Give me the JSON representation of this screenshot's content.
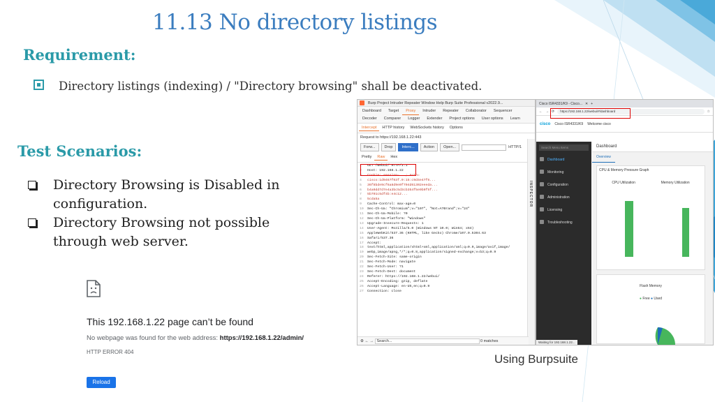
{
  "slide": {
    "title": "11.13 No directory listings",
    "requirement_heading": "Requirement:",
    "requirement_text": "Directory listings (indexing) / \"Directory browsing\" shall be deactivated.",
    "test_heading": "Test Scenarios:",
    "scenarios": [
      "Directory Browsing is Disabled in configuration.",
      "Directory Browsing not possible through web server."
    ],
    "caption": "Using Burpsuite"
  },
  "error_page": {
    "title": "This 192.168.1.22 page can’t be found",
    "desc_prefix": "No webpage was found for the web address: ",
    "desc_url": "https://192.168.1.22/admin/",
    "code": "HTTP ERROR 404",
    "reload_label": "Reload"
  },
  "burp": {
    "window_title": "Burp  Project  Intruder  Repeater  Window  Help  Burp Suite Professional v2022.9...",
    "tabs": [
      "Dashboard",
      "Target",
      "Proxy",
      "Intruder",
      "Repeater",
      "Collaborator",
      "Sequencer",
      "Decoder",
      "Comparer",
      "Logger",
      "Extender",
      "Project options",
      "User options",
      "Learn"
    ],
    "active_tab": "Proxy",
    "subtabs": [
      "Intercept",
      "HTTP history",
      "WebSockets history",
      "Options"
    ],
    "request_line": "Request to https://192.168.1.22:443",
    "buttons": [
      "Forw...",
      "Drop",
      "Interc...",
      "Action",
      "Open..."
    ],
    "protocol": "HTTP/1",
    "view_tabs": [
      "Pretty",
      "Raw",
      "Hex"
    ],
    "request_lines": [
      "GET /webui/ HTTP/1.1",
      "Host: 192.168.1.22",
      "Cookie: session=...; Auth=",
      "cisco:1d9467f03f.0:15:c9d4e47f6...",
      "36f8bde9cf6a8d9e0f704d61302eeeda...",
      "b4a0dd7d7e4a3bc5d3cb354f5e9b9f5f...",
      "5b701c5df4b:e4c12...",
      "5cda5a",
      "Cache-Control: max-age=0",
      "Sec-Ch-Ua: \"Chromium\";v=\"107\", \"Not=A?Brand\";v=\"24\"",
      "Sec-Ch-Ua-Mobile: ?0",
      "Sec-Ch-Ua-Platform: \"Windows\"",
      "Upgrade-Insecure-Requests: 1",
      "User-Agent: Mozilla/5.0 (Windows NT 10.0; Win64; x64)",
      "AppleWebKit/537.36 (KHTML, like Gecko) Chrome/107.0.5304.63",
      "Safari/537.36",
      "Accept:",
      "text/html,application/xhtml+xml,application/xml;q=0.9,image/avif,image/",
      "webp,image/apng,*/*;q=0.8,application/signed-exchange;v=b3;q=0.9",
      "Sec-Fetch-Site: same-origin",
      "Sec-Fetch-Mode: navigate",
      "Sec-Fetch-User: ?1",
      "Sec-Fetch-Dest: document",
      "Referer: https://192.168.1.22/webui/",
      "Accept-Encoding: gzip, deflate",
      "Accept-Language: en-US,en;q=0.9",
      "Connection: close"
    ],
    "inspector_label": "INSPECTOR",
    "search_placeholder": "Search...",
    "matches": "0 matches"
  },
  "cisco": {
    "tab_title": "Cisco ISR4331/K9 - Cisco...",
    "url": "https://192.168.1.22/webui/#/dashboard",
    "product": "Cisco ISR4331/K9",
    "welcome": "Welcome cisco",
    "sidebar_search": "Search Menu Items",
    "sidebar_items": [
      "Dashboard",
      "Monitoring",
      "Configuration",
      "Administration",
      "Licensing",
      "Troubleshooting"
    ],
    "page_title": "Dashboard",
    "overview_tab": "Overview",
    "card1_title": "CPU & Memory Pressure Graph",
    "cpu_label": "CPU Utilization",
    "mem_label": "Memory Utilization",
    "card2_title": "Flash Memory",
    "legend_free": "Free",
    "legend_used": "Used",
    "status_bar": "Waiting for 192.168.1.22..."
  },
  "colors": {
    "title": "#3b7dbf",
    "heading": "#2a9aa8",
    "highlight_box": "#dd0000",
    "burp_accent": "#e8702a",
    "cisco_blue": "#049fd9"
  }
}
